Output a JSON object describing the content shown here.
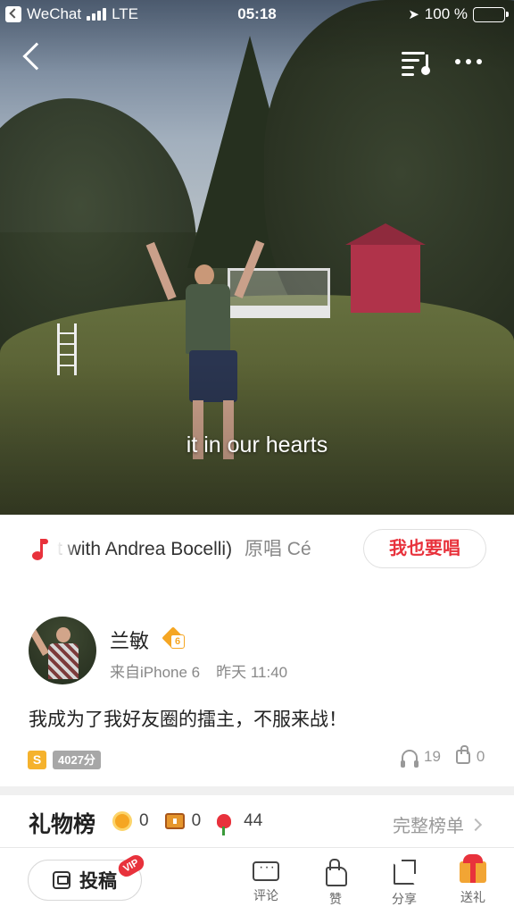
{
  "status_bar": {
    "app_back_label": "WeChat",
    "network": "LTE",
    "time": "05:18",
    "battery_text": "100 %",
    "battery_level_percent": 100
  },
  "hero": {
    "lyric": "it in our hearts"
  },
  "song": {
    "title_scroll": "t with Andrea Bocelli)",
    "original_singer_label": "原唱 Cé",
    "sing_button": "我也要唱"
  },
  "post": {
    "username": "兰敏",
    "level": "6",
    "source": "来自iPhone 6",
    "time": "昨天 11:40",
    "text": "我成为了我好友圈的擂主，不服来战！",
    "rank_badge": "S",
    "score": "4027分",
    "listen_count": "19",
    "like_count": "0"
  },
  "gifts": {
    "title": "礼物榜",
    "coin_count": "0",
    "chest_count": "0",
    "flower_count": "44",
    "full_list_label": "完整榜单"
  },
  "bottom_bar": {
    "post_button": "投稿",
    "vip_badge": "VIP",
    "comment_label": "评论",
    "like_label": "赞",
    "share_label": "分享",
    "gift_label": "送礼"
  },
  "colors": {
    "accent_red": "#e8323c",
    "gold": "#f5a623",
    "battery_green": "#3ecf4a"
  },
  "icons": [
    "back-app-icon",
    "signal-icon",
    "battery-icon",
    "back-arrow-icon",
    "playlist-icon",
    "more-icon",
    "music-note-icon",
    "level-badge-icon",
    "headphone-icon",
    "thumb-up-icon",
    "coin-icon",
    "chest-icon",
    "flower-icon",
    "chevron-right-icon",
    "post-icon",
    "comment-icon",
    "like-icon",
    "share-icon",
    "gift-icon"
  ]
}
